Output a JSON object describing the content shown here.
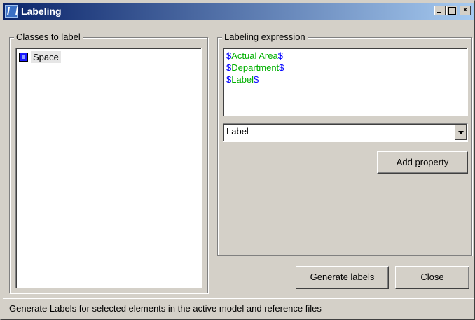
{
  "window": {
    "title": "Labeling",
    "controls": {
      "minimize": "",
      "maximize": "",
      "close": "×"
    }
  },
  "classes_group": {
    "label_pre": "C",
    "label_accel": "l",
    "label_post": "asses to label",
    "items": [
      {
        "label": "Space",
        "icon": "class-icon"
      }
    ]
  },
  "expression_group": {
    "label_pre": "Labeling ",
    "label_accel": "e",
    "label_post": "xpression",
    "lines": [
      {
        "open": "$",
        "name": "Actual Area",
        "close": "$"
      },
      {
        "open": "$",
        "name": "Department",
        "close": "$"
      },
      {
        "open": "$",
        "name": "Label",
        "close": "$"
      }
    ],
    "property_select": {
      "value": "Label"
    },
    "add_property_button": {
      "pre": "Add ",
      "accel": "p",
      "post": "roperty"
    }
  },
  "buttons": {
    "generate": {
      "accel": "G",
      "post": "enerate labels"
    },
    "close": {
      "accel": "C",
      "post": "lose"
    }
  },
  "status": {
    "text": "Generate Labels for selected elements in the active model and reference files"
  },
  "colors": {
    "face": "#d4d0c8",
    "title_start": "#0a246a",
    "title_end": "#a6caf0",
    "property_name": "#00b000",
    "token": "#0000ff"
  }
}
